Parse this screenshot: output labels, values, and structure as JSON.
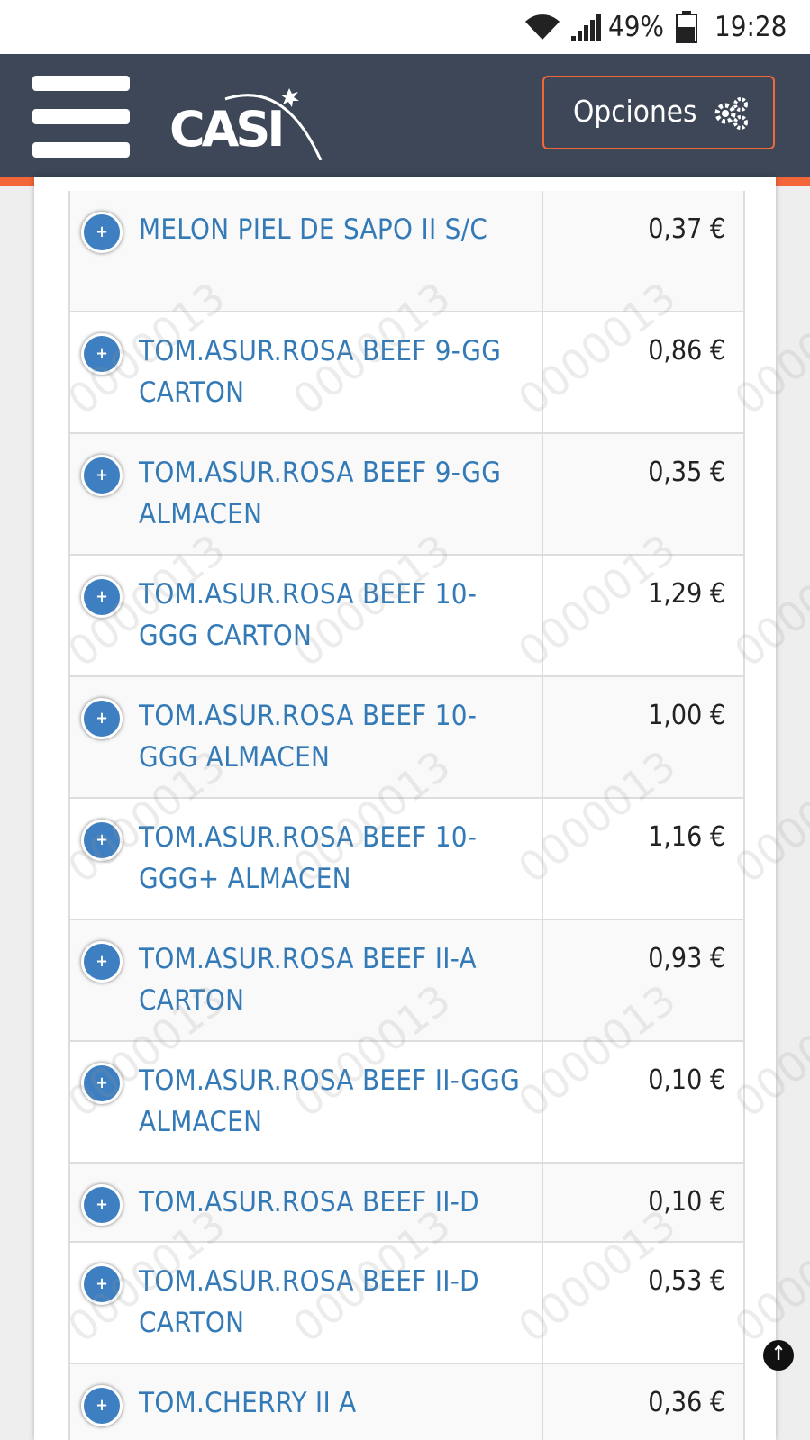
{
  "status_bar": {
    "battery_percent": "49%",
    "time": "19:28",
    "icons": [
      "wifi-icon",
      "signal-icon",
      "battery-icon"
    ]
  },
  "header": {
    "logo_text": "CASI",
    "options_label": "Opciones",
    "options_icon": "gears-icon",
    "colors": {
      "bar": "#3e4757",
      "accent": "#f2663a"
    }
  },
  "watermark_text": "0000013",
  "products": [
    {
      "name": "MELON PIEL DE SAPO II S/C",
      "price": "0,37 €"
    },
    {
      "name": "TOM.ASUR.ROSA BEEF 9-GG CARTON",
      "price": "0,86 €"
    },
    {
      "name": "TOM.ASUR.ROSA BEEF 9-GG ALMACEN",
      "price": "0,35 €"
    },
    {
      "name": "TOM.ASUR.ROSA BEEF 10-GGG CARTON",
      "price": "1,29 €"
    },
    {
      "name": "TOM.ASUR.ROSA BEEF 10-GGG ALMACEN",
      "price": "1,00 €"
    },
    {
      "name": "TOM.ASUR.ROSA BEEF 10-GGG+ ALMACEN",
      "price": "1,16 €"
    },
    {
      "name": "TOM.ASUR.ROSA BEEF II-A CARTON",
      "price": "0,93 €"
    },
    {
      "name": "TOM.ASUR.ROSA BEEF II-GGG ALMACEN",
      "price": "0,10 €"
    },
    {
      "name": "TOM.ASUR.ROSA BEEF II-D",
      "price": "0,10 €"
    },
    {
      "name": "TOM.ASUR.ROSA BEEF II-D CARTON",
      "price": "0,53 €"
    },
    {
      "name": "TOM.CHERRY II A",
      "price": "0,36 €"
    }
  ],
  "row_expand_icon": "plus-icon",
  "scroll_top_icon": "arrow-up-icon"
}
